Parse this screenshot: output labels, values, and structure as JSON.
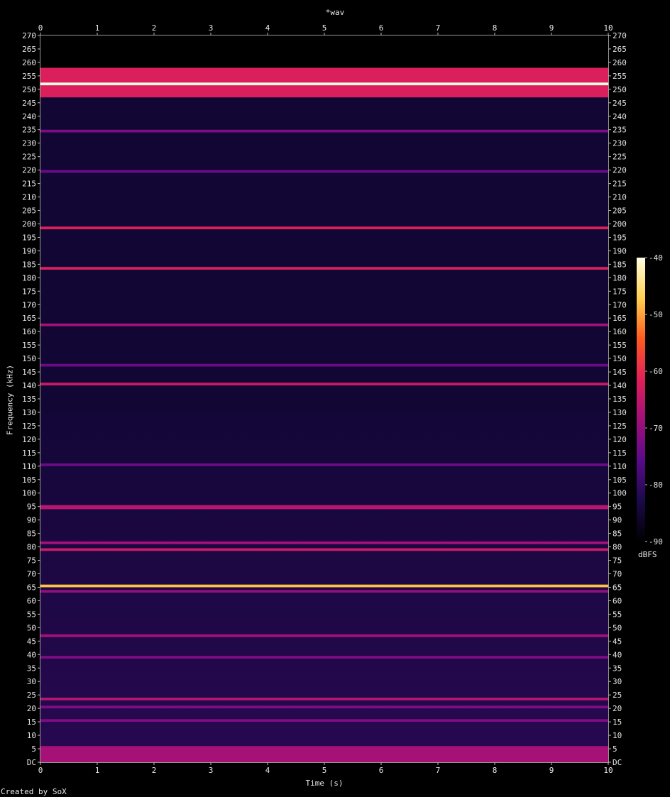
{
  "chart_data": {
    "type": "heatmap",
    "title": "*wav",
    "xlabel": "Time (s)",
    "ylabel": "Frequency (kHz)",
    "xlim": [
      0,
      10
    ],
    "ylim": [
      0,
      270
    ],
    "x_ticks": [
      "0",
      "1",
      "2",
      "3",
      "4",
      "5",
      "6",
      "7",
      "8",
      "9",
      "10"
    ],
    "y_ticks": [
      "DC",
      "5",
      "10",
      "15",
      "20",
      "25",
      "30",
      "35",
      "40",
      "45",
      "50",
      "55",
      "60",
      "65",
      "70",
      "75",
      "80",
      "85",
      "90",
      "95",
      "100",
      "105",
      "110",
      "115",
      "120",
      "125",
      "130",
      "135",
      "140",
      "145",
      "150",
      "155",
      "160",
      "165",
      "170",
      "175",
      "180",
      "185",
      "190",
      "195",
      "200",
      "205",
      "210",
      "215",
      "220",
      "225",
      "230",
      "235",
      "240",
      "245",
      "250",
      "255",
      "260",
      "265",
      "270"
    ],
    "colorbar": {
      "label": "dBFS",
      "range": [
        -90,
        -40
      ],
      "ticks": [
        "-40",
        "-50",
        "-60",
        "-70",
        "-80",
        "-90"
      ],
      "colors": [
        "#000000",
        "#1a0a4a",
        "#5a0a8a",
        "#a0107a",
        "#e0205a",
        "#ff5a20",
        "#ffd050",
        "#ffffe0"
      ]
    },
    "bands": [
      {
        "from": 247,
        "to": 258,
        "level_dbfs": -62
      },
      {
        "from": 251.5,
        "to": 252.5,
        "level_dbfs": -40
      },
      {
        "from": 234,
        "to": 235,
        "level_dbfs": -72
      },
      {
        "from": 219,
        "to": 220,
        "level_dbfs": -74
      },
      {
        "from": 198,
        "to": 199,
        "level_dbfs": -62
      },
      {
        "from": 183,
        "to": 184,
        "level_dbfs": -62
      },
      {
        "from": 162,
        "to": 163,
        "level_dbfs": -68
      },
      {
        "from": 140,
        "to": 141,
        "level_dbfs": -64
      },
      {
        "from": 147,
        "to": 148,
        "level_dbfs": -74
      },
      {
        "from": 110,
        "to": 111,
        "level_dbfs": -74
      },
      {
        "from": 94,
        "to": 95.5,
        "level_dbfs": -66
      },
      {
        "from": 81,
        "to": 82,
        "level_dbfs": -68
      },
      {
        "from": 78.5,
        "to": 79.5,
        "level_dbfs": -64
      },
      {
        "from": 65,
        "to": 66,
        "level_dbfs": -48
      },
      {
        "from": 63,
        "to": 64,
        "level_dbfs": -70
      },
      {
        "from": 46.5,
        "to": 47.5,
        "level_dbfs": -68
      },
      {
        "from": 38.5,
        "to": 39.5,
        "level_dbfs": -72
      },
      {
        "from": 23,
        "to": 24,
        "level_dbfs": -66
      },
      {
        "from": 20,
        "to": 21,
        "level_dbfs": -72
      },
      {
        "from": 15,
        "to": 16,
        "level_dbfs": -72
      },
      {
        "from": 0,
        "to": 6,
        "level_dbfs": -68
      }
    ]
  },
  "footer": {
    "credit": "Created by SoX"
  }
}
